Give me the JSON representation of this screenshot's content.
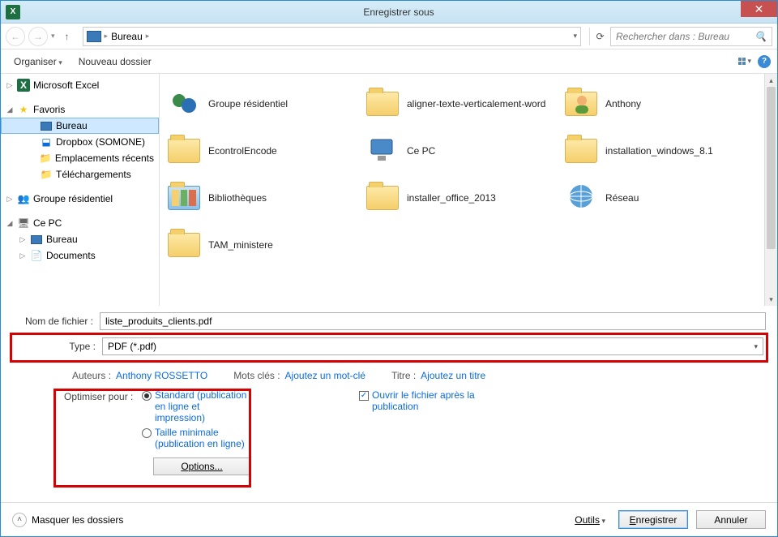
{
  "window": {
    "title": "Enregistrer sous",
    "app_icon_text": "X"
  },
  "nav": {
    "breadcrumb_location": "Bureau",
    "search_placeholder": "Rechercher dans : Bureau"
  },
  "toolbar": {
    "organize": "Organiser",
    "new_folder": "Nouveau dossier"
  },
  "sidebar": {
    "items": [
      {
        "label": "Microsoft Excel",
        "kind": "excel",
        "expandable": true,
        "depth": 0
      },
      {
        "label": "Favoris",
        "kind": "star",
        "expanded": true,
        "depth": 0
      },
      {
        "label": "Bureau",
        "kind": "monitor",
        "selected": true,
        "depth": 1
      },
      {
        "label": "Dropbox (SOMONE)",
        "kind": "dropbox",
        "depth": 1
      },
      {
        "label": "Emplacements récents",
        "kind": "folder-pin",
        "depth": 1
      },
      {
        "label": "Téléchargements",
        "kind": "folder",
        "depth": 1
      },
      {
        "label": "Groupe résidentiel",
        "kind": "group",
        "expandable": true,
        "depth": 0
      },
      {
        "label": "Ce PC",
        "kind": "pc",
        "expanded": true,
        "depth": 0
      },
      {
        "label": "Bureau",
        "kind": "monitor",
        "expandable": true,
        "depth": 1
      },
      {
        "label": "Documents",
        "kind": "docs",
        "expandable": true,
        "depth": 1
      }
    ]
  },
  "files": [
    {
      "label": "Groupe résidentiel",
      "kind": "group"
    },
    {
      "label": "Anthony",
      "kind": "user"
    },
    {
      "label": "Ce PC",
      "kind": "pc"
    },
    {
      "label": "Bibliothèques",
      "kind": "library"
    },
    {
      "label": "Réseau",
      "kind": "network"
    },
    {
      "label": "aligner-texte-verticalement-word",
      "kind": "folder"
    },
    {
      "label": "EcontrolEncode",
      "kind": "folder"
    },
    {
      "label": "installation_windows_8.1",
      "kind": "folder"
    },
    {
      "label": "installer_office_2013",
      "kind": "folder"
    },
    {
      "label": "TAM_ministere",
      "kind": "folder"
    }
  ],
  "fields": {
    "filename_label": "Nom de fichier :",
    "filename_value": "liste_produits_clients.pdf",
    "type_label": "Type :",
    "type_value": "PDF (*.pdf)"
  },
  "meta": {
    "authors_label": "Auteurs :",
    "authors_value": "Anthony ROSSETTO",
    "keywords_label": "Mots clés :",
    "keywords_value": "Ajoutez un mot-clé",
    "title_label": "Titre :",
    "title_value": "Ajoutez un titre"
  },
  "optimize": {
    "label": "Optimiser pour :",
    "standard": "Standard (publication en ligne et impression)",
    "minimal": "Taille minimale (publication en ligne)",
    "options_btn": "Options...",
    "open_after_label": "Ouvrir le fichier après la publication"
  },
  "footer": {
    "hide_folders": "Masquer les dossiers",
    "tools": "Outils",
    "save": "Enregistrer",
    "cancel": "Annuler"
  }
}
